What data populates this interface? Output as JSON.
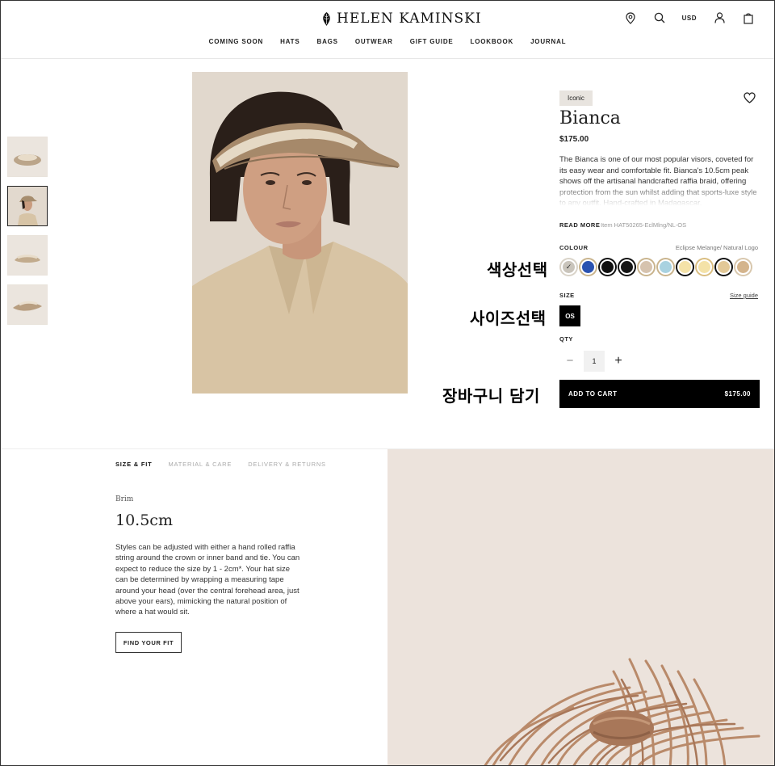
{
  "brand": {
    "name": "HELEN KAMINSKI"
  },
  "nav": [
    "COMING SOON",
    "HATS",
    "BAGS",
    "OUTWEAR",
    "GIFT GUIDE",
    "LOOKBOOK",
    "JOURNAL"
  ],
  "header": {
    "currency": "USD"
  },
  "product": {
    "badge": "Iconic",
    "title": "Bianca",
    "price": "$175.00",
    "description": "The Bianca is one of our most popular visors, coveted for its easy wear and comfortable fit. Bianca's 10.5cm peak shows off the artisanal handcrafted raffia braid, offering protection from the sun whilst adding that sports-luxe style to any outfit. Hand-crafted in Madagascar.",
    "read_more": "READ MORE",
    "sku": "Item HAT50265-EclMlng/NL-OS",
    "colour_label": "COLOUR",
    "colour_name": "Eclipse Melange/ Natural Logo",
    "swatches": [
      {
        "name": "eclipse-melange",
        "color": "#c9c4bb",
        "ring": "#d9d3c8",
        "selected": true
      },
      {
        "name": "blue",
        "color": "#2a52b0",
        "ring": "#c9b48d"
      },
      {
        "name": "black-1",
        "color": "#111111",
        "ring": "#111111"
      },
      {
        "name": "black-2",
        "color": "#161616",
        "ring": "#111111"
      },
      {
        "name": "sand",
        "color": "#d6c3ae",
        "ring": "#c9b48d"
      },
      {
        "name": "light-blue",
        "color": "#a9d2e0",
        "ring": "#c9b48d"
      },
      {
        "name": "cream-black",
        "color": "#f4e2a8",
        "ring": "#111111"
      },
      {
        "name": "cream",
        "color": "#f4e2a8",
        "ring": "#d9bd80"
      },
      {
        "name": "natural-black",
        "color": "#e2c897",
        "ring": "#111111"
      },
      {
        "name": "tan",
        "color": "#d4b48c",
        "ring": "#d8c7ad"
      }
    ],
    "size_label": "SIZE",
    "size_guide": "Size guide",
    "size_value": "OS",
    "qty_label": "QTY",
    "qty_value": "1",
    "add_to_cart": "ADD TO CART",
    "cart_price": "$175.00"
  },
  "annotations": {
    "colour": "색상선택",
    "size": "사이즈선택",
    "cart": "장바구니 담기"
  },
  "details": {
    "tabs": [
      "SIZE & FIT",
      "MATERIAL & CARE",
      "DELIVERY & RETURNS"
    ],
    "brim_label": "Brim",
    "brim_value": "10.5cm",
    "fit_text": "Styles can be adjusted with either a hand rolled raffia string around the crown or inner band and tie. You can expect to reduce the size by 1 - 2cm*. Your hat size can be determined by wrapping a measuring tape around your head (over the central forehead area, just above your ears), mimicking the natural position of where a hat would sit.",
    "find_fit": "FIND YOUR FIT"
  }
}
